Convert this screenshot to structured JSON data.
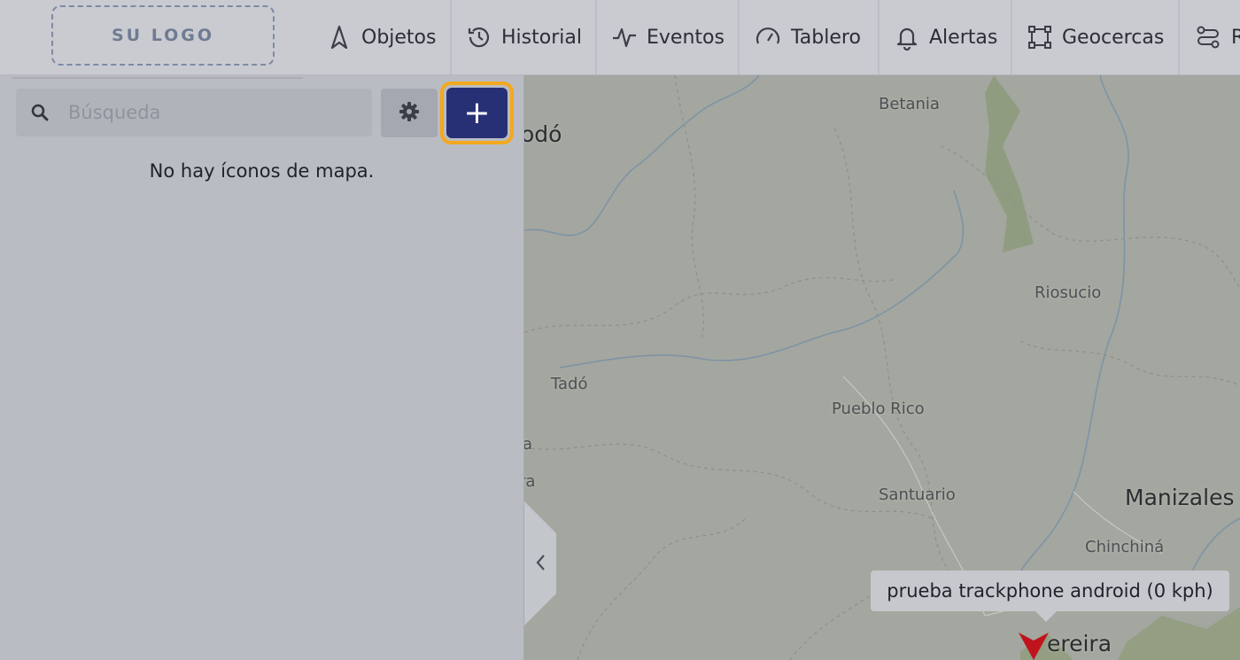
{
  "header": {
    "logo_text": "SU LOGO",
    "nav": [
      {
        "label": "Objetos",
        "icon": "navigation-arrow-icon"
      },
      {
        "label": "Historial",
        "icon": "history-icon"
      },
      {
        "label": "Eventos",
        "icon": "pulse-icon"
      },
      {
        "label": "Tablero",
        "icon": "gauge-icon"
      },
      {
        "label": "Alertas",
        "icon": "bell-icon"
      },
      {
        "label": "Geocercas",
        "icon": "geofence-icon"
      },
      {
        "label": "R",
        "icon": "route-icon"
      }
    ]
  },
  "sidebar": {
    "search": {
      "placeholder": "Búsqueda",
      "value": ""
    },
    "settings_icon": "gear-icon",
    "add_icon": "plus-icon",
    "add_label": "+",
    "empty_message": "No hay íconos de mapa."
  },
  "map": {
    "places": [
      "odó",
      "Betania",
      "Riosucio",
      "Tadó",
      "Pueblo Rico",
      "Santuario",
      "Manizales",
      "Chinchiná",
      "ereira",
      "a",
      "ra"
    ],
    "tooltip": "prueba trackphone android (0 kph)",
    "colors": {
      "accent": "#f4a81d",
      "primary_button": "#283075",
      "marker": "#c0141c"
    }
  }
}
